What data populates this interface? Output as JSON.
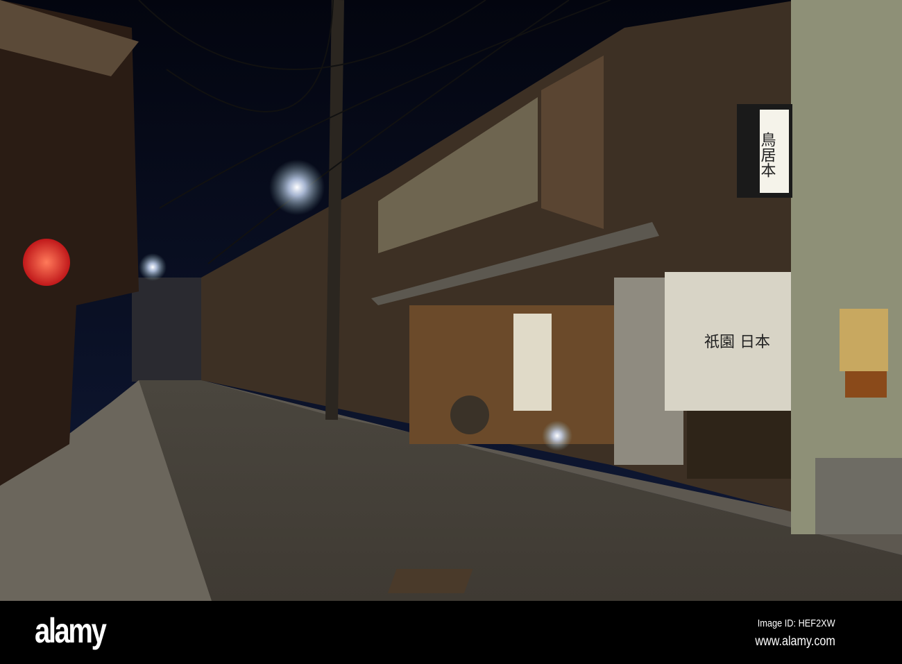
{
  "photo": {
    "sign_text": "鳥居本",
    "noren_text": "祇園 日本",
    "colors": {
      "sky": "#06091a",
      "road": "#5a5346",
      "wood": "#4a3a2a",
      "lantern": "#e8352a"
    }
  },
  "footer": {
    "logo": "alamy",
    "image_id": "Image ID: HEF2XW",
    "website": "www.alamy.com"
  }
}
